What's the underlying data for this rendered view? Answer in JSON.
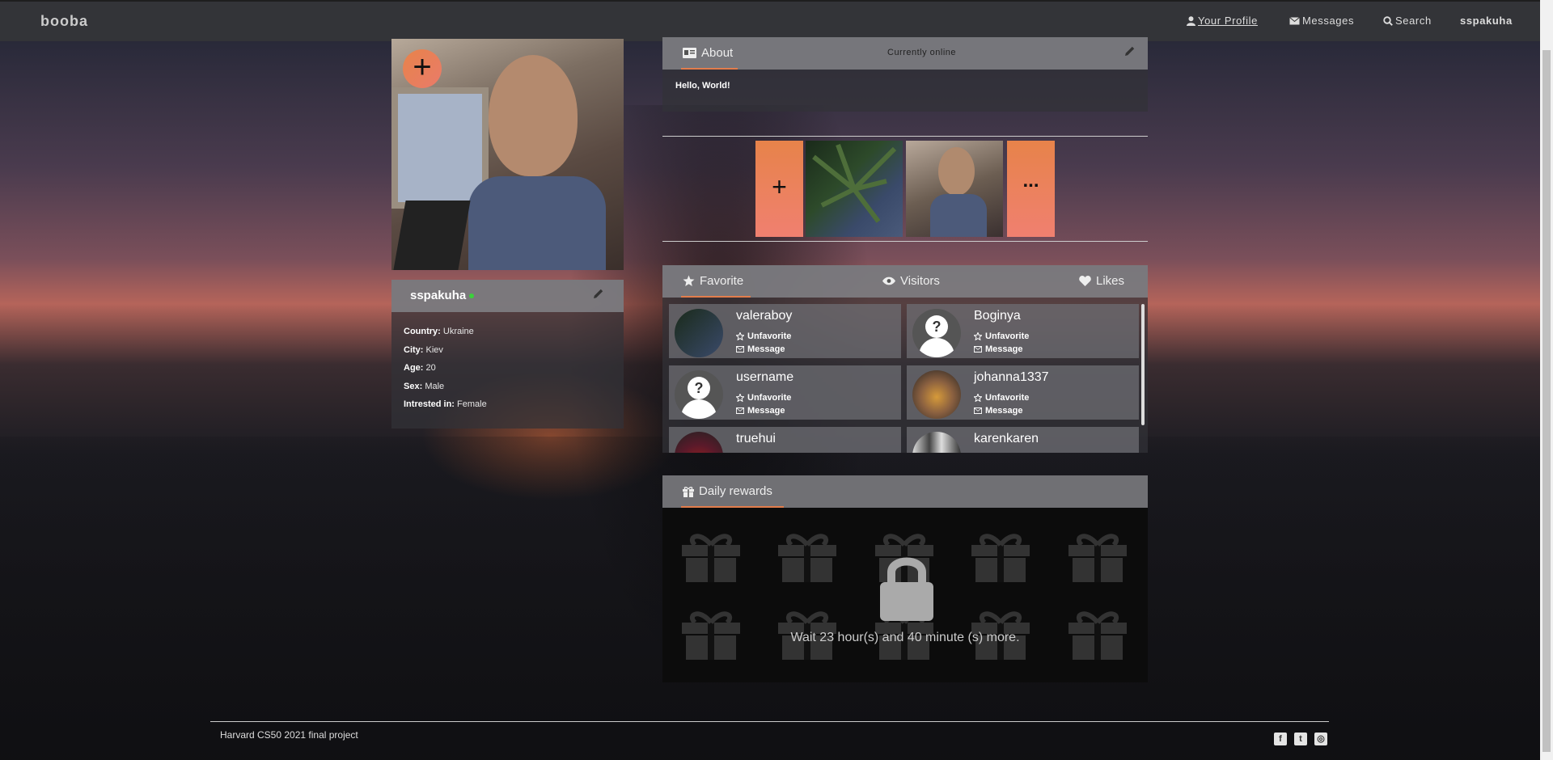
{
  "nav": {
    "brand": "booba",
    "items": [
      {
        "label": "Your Profile",
        "icon": "user-icon"
      },
      {
        "label": "Messages",
        "icon": "envelope-icon"
      },
      {
        "label": "Search",
        "icon": "search-icon"
      }
    ],
    "username": "sspakuha"
  },
  "profile": {
    "name": "sspakuha",
    "online": true,
    "country_label": "Country:",
    "country": "Ukraine",
    "city_label": "City:",
    "city": "Kiev",
    "age_label": "Age:",
    "age": "20",
    "sex_label": "Sex:",
    "sex": "Male",
    "interest_label": "Intrested in:",
    "interest": "Female"
  },
  "about": {
    "title": "About",
    "status": "Currently online",
    "text": "Hello, World!"
  },
  "gallery": {
    "add_label": "+",
    "more_label": "..."
  },
  "favorites": {
    "tabs": [
      {
        "label": "Favorite",
        "icon": "star-icon"
      },
      {
        "label": "Visitors",
        "icon": "eye-icon"
      },
      {
        "label": "Likes",
        "icon": "heart-icon"
      }
    ],
    "unfavorite_label": "Unfavorite",
    "message_label": "Message",
    "users": [
      {
        "name": "valeraboy"
      },
      {
        "name": "Boginya"
      },
      {
        "name": "username"
      },
      {
        "name": "johanna1337"
      },
      {
        "name": "truehui"
      },
      {
        "name": "karenkaren"
      }
    ]
  },
  "rewards": {
    "title": "Daily rewards",
    "message": "Wait 23 hour(s) and 40 minute (s) more."
  },
  "footer": {
    "text": "Harvard CS50 2021 final project",
    "social": [
      "facebook-icon",
      "twitter-icon",
      "instagram-icon"
    ]
  },
  "colors": {
    "accent": "#e7834a",
    "online": "#3bd13b",
    "navbar": "#333438"
  }
}
